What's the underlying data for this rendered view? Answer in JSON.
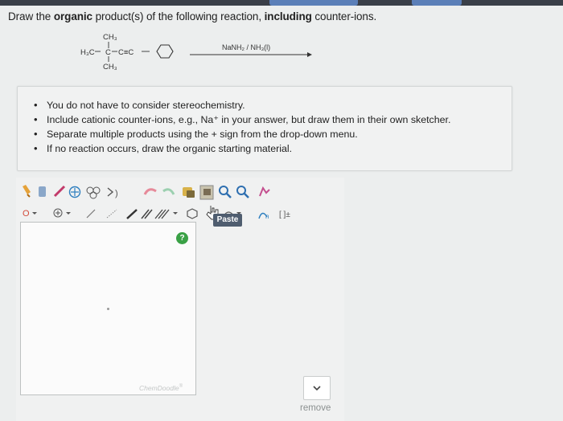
{
  "question": {
    "prefix": "Draw the ",
    "bold1": "organic",
    "middle": " product(s) of the following reaction, ",
    "bold2": "including",
    "suffix": " counter-ions."
  },
  "reaction": {
    "substituent_top": "CH₃",
    "substituent_left": "H₃C",
    "center_carbon": "C",
    "alkyne": "C≡C",
    "substituent_bottom": "CH₃",
    "reagent": "NaNH₂ / NH₃(l)"
  },
  "instructions": [
    "You do not have to consider stereochemistry.",
    "Include cationic counter-ions, e.g., Na⁺ in your answer, but draw them in their own sketcher.",
    "Separate multiple products using the + sign from the drop-down menu.",
    "If no reaction occurs, draw the organic starting material."
  ],
  "sketcher": {
    "paste_label": "Paste",
    "watermark": "ChemDoodle",
    "watermark_mark": "®",
    "help_label": "?",
    "charge_label": "[ ]±"
  },
  "remove_label": "remove"
}
